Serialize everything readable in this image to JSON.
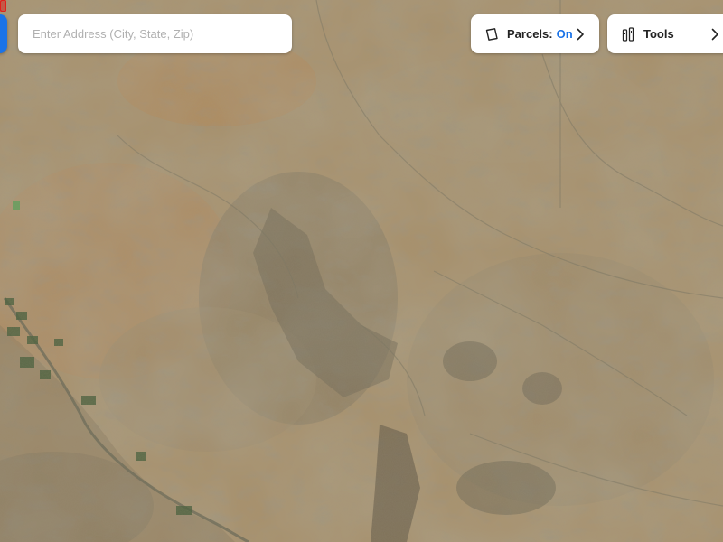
{
  "search": {
    "placeholder": "Enter Address (City, State, Zip)",
    "value": ""
  },
  "toolbar": {
    "parcels_label": "Parcels:",
    "parcels_value": "On",
    "tools_label": "Tools"
  },
  "icons": {
    "parcels": "polygon-outline-icon",
    "parcels_chevron": "chevron-right-icon",
    "tools": "ruler-tools-icon",
    "tools_chevron": "chevron-right-icon"
  },
  "map": {
    "type": "satellite",
    "marker_color": "#e0201a"
  },
  "colors": {
    "accent": "#1a73e8",
    "marker": "#e0201a"
  }
}
